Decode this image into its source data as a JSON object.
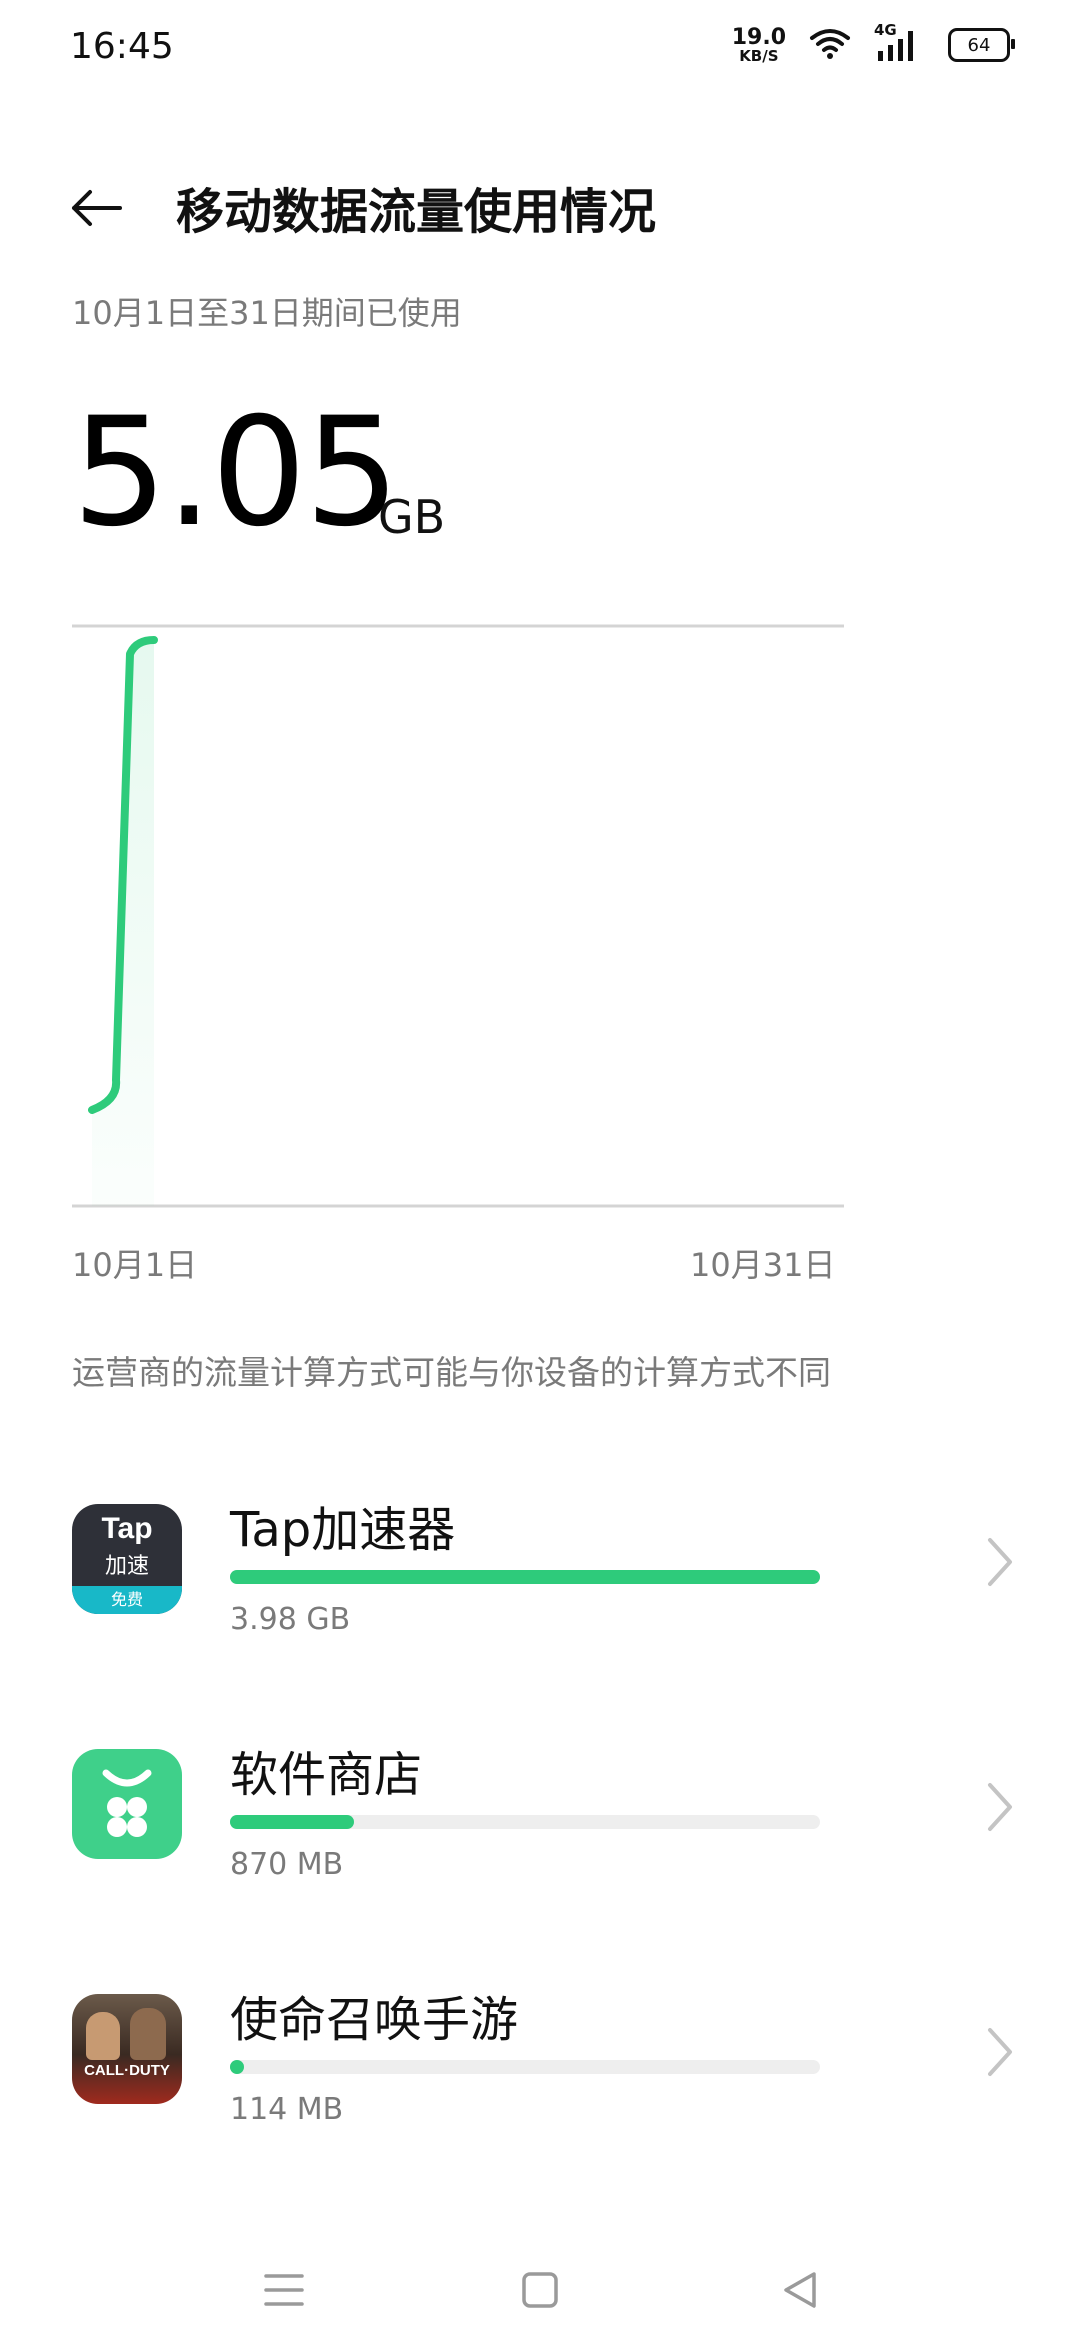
{
  "status_bar": {
    "time": "16:45",
    "speed_value": "19.0",
    "speed_unit": "KB/S",
    "network": "4G",
    "battery": "64"
  },
  "header": {
    "title": "移动数据流量使用情况",
    "period": "10月1日至31日期间已使用"
  },
  "total": {
    "value": "5.05",
    "unit": "GB"
  },
  "chart": {
    "start_label": "10月1日",
    "end_label": "10月31日",
    "line_color": "#2ecb7b"
  },
  "chart_data": {
    "type": "line",
    "x": [
      "10月1日",
      "10月2日",
      "10月3日"
    ],
    "values": [
      0,
      0.05,
      5.05
    ],
    "xlabel": "",
    "ylabel": "",
    "ylim": [
      0,
      5.05
    ],
    "grid": true
  },
  "note": "运营商的流量计算方式可能与你设备的计算方式不同",
  "apps": [
    {
      "name": "Tap加速器",
      "usage": "3.98 GB",
      "fraction": 1.0,
      "icon_name": "tap-accelerator-icon",
      "icon_text_1": "Tap",
      "icon_text_2": "加速",
      "icon_badge": "免费"
    },
    {
      "name": "软件商店",
      "usage": "870 MB",
      "fraction": 0.21,
      "icon_name": "app-store-icon"
    },
    {
      "name": "使命召唤手游",
      "usage": "114 MB",
      "fraction": 0.02,
      "icon_name": "call-of-duty-icon",
      "icon_text_1": "CALL·DUTY"
    }
  ],
  "nav": {
    "menu_icon": "menu-icon",
    "home_icon": "home-icon",
    "back_icon": "back-triangle-icon"
  }
}
